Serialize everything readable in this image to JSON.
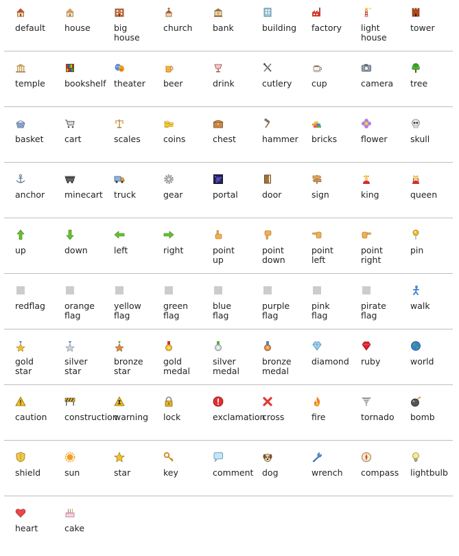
{
  "rows": [
    [
      {
        "label": "default",
        "icon": "default-house-icon"
      },
      {
        "label": "house",
        "icon": "house-icon"
      },
      {
        "label": "big\nhouse",
        "icon": "big-house-icon"
      },
      {
        "label": "church",
        "icon": "church-icon"
      },
      {
        "label": "bank",
        "icon": "bank-icon"
      },
      {
        "label": "building",
        "icon": "building-icon"
      },
      {
        "label": "factory",
        "icon": "factory-icon"
      },
      {
        "label": "light\nhouse",
        "icon": "lighthouse-icon"
      },
      {
        "label": "tower",
        "icon": "tower-icon"
      }
    ],
    [
      {
        "label": "temple",
        "icon": "temple-icon"
      },
      {
        "label": "bookshelf",
        "icon": "bookshelf-icon"
      },
      {
        "label": "theater",
        "icon": "theater-icon"
      },
      {
        "label": "beer",
        "icon": "beer-icon"
      },
      {
        "label": "drink",
        "icon": "drink-icon"
      },
      {
        "label": "cutlery",
        "icon": "cutlery-icon"
      },
      {
        "label": "cup",
        "icon": "cup-icon"
      },
      {
        "label": "camera",
        "icon": "camera-icon"
      },
      {
        "label": "tree",
        "icon": "tree-icon"
      }
    ],
    [
      {
        "label": "basket",
        "icon": "basket-icon"
      },
      {
        "label": "cart",
        "icon": "cart-icon"
      },
      {
        "label": "scales",
        "icon": "scales-icon"
      },
      {
        "label": "coins",
        "icon": "coins-icon"
      },
      {
        "label": "chest",
        "icon": "chest-icon"
      },
      {
        "label": "hammer",
        "icon": "hammer-icon"
      },
      {
        "label": "bricks",
        "icon": "bricks-icon"
      },
      {
        "label": "flower",
        "icon": "flower-icon"
      },
      {
        "label": "skull",
        "icon": "skull-icon"
      }
    ],
    [
      {
        "label": "anchor",
        "icon": "anchor-icon"
      },
      {
        "label": "minecart",
        "icon": "minecart-icon"
      },
      {
        "label": "truck",
        "icon": "truck-icon"
      },
      {
        "label": "gear",
        "icon": "gear-icon"
      },
      {
        "label": "portal",
        "icon": "portal-icon"
      },
      {
        "label": "door",
        "icon": "door-icon"
      },
      {
        "label": "sign",
        "icon": "sign-icon"
      },
      {
        "label": "king",
        "icon": "king-icon"
      },
      {
        "label": "queen",
        "icon": "queen-icon"
      }
    ],
    [
      {
        "label": "up",
        "icon": "arrow-up-icon"
      },
      {
        "label": "down",
        "icon": "arrow-down-icon"
      },
      {
        "label": "left",
        "icon": "arrow-left-icon"
      },
      {
        "label": "right",
        "icon": "arrow-right-icon"
      },
      {
        "label": "point\nup",
        "icon": "point-up-icon"
      },
      {
        "label": "point\ndown",
        "icon": "point-down-icon"
      },
      {
        "label": "point\nleft",
        "icon": "point-left-icon"
      },
      {
        "label": "point\nright",
        "icon": "point-right-icon"
      },
      {
        "label": "pin",
        "icon": "pin-icon"
      }
    ],
    [
      {
        "label": "redflag",
        "icon": "red-flag-icon"
      },
      {
        "label": "orange\nflag",
        "icon": "orange-flag-icon"
      },
      {
        "label": "yellow\nflag",
        "icon": "yellow-flag-icon"
      },
      {
        "label": "green\nflag",
        "icon": "green-flag-icon"
      },
      {
        "label": "blue\nflag",
        "icon": "blue-flag-icon"
      },
      {
        "label": "purple\nflag",
        "icon": "purple-flag-icon"
      },
      {
        "label": "pink\nflag",
        "icon": "pink-flag-icon"
      },
      {
        "label": "pirate\nflag",
        "icon": "pirate-flag-icon"
      },
      {
        "label": "walk",
        "icon": "walk-icon"
      }
    ],
    [
      {
        "label": "gold\nstar",
        "icon": "gold-star-icon"
      },
      {
        "label": "silver\nstar",
        "icon": "silver-star-icon"
      },
      {
        "label": "bronze\nstar",
        "icon": "bronze-star-icon"
      },
      {
        "label": "gold\nmedal",
        "icon": "gold-medal-icon"
      },
      {
        "label": "silver\nmedal",
        "icon": "silver-medal-icon"
      },
      {
        "label": "bronze\nmedal",
        "icon": "bronze-medal-icon"
      },
      {
        "label": "diamond",
        "icon": "diamond-icon"
      },
      {
        "label": "ruby",
        "icon": "ruby-icon"
      },
      {
        "label": "world",
        "icon": "world-icon"
      }
    ],
    [
      {
        "label": "caution",
        "icon": "caution-icon"
      },
      {
        "label": "construction",
        "icon": "construction-icon"
      },
      {
        "label": "warning",
        "icon": "warning-icon"
      },
      {
        "label": "lock",
        "icon": "lock-icon"
      },
      {
        "label": "exclamation",
        "icon": "exclamation-icon"
      },
      {
        "label": "cross",
        "icon": "cross-icon"
      },
      {
        "label": "fire",
        "icon": "fire-icon"
      },
      {
        "label": "tornado",
        "icon": "tornado-icon"
      },
      {
        "label": "bomb",
        "icon": "bomb-icon"
      }
    ],
    [
      {
        "label": "shield",
        "icon": "shield-icon"
      },
      {
        "label": "sun",
        "icon": "sun-icon"
      },
      {
        "label": "star",
        "icon": "star-icon"
      },
      {
        "label": "key",
        "icon": "key-icon"
      },
      {
        "label": "comment",
        "icon": "comment-icon"
      },
      {
        "label": "dog",
        "icon": "dog-icon"
      },
      {
        "label": "wrench",
        "icon": "wrench-icon"
      },
      {
        "label": "compass",
        "icon": "compass-icon"
      },
      {
        "label": "lightbulb",
        "icon": "lightbulb-icon"
      }
    ],
    [
      {
        "label": "heart",
        "icon": "heart-icon"
      },
      {
        "label": "cake",
        "icon": "cake-icon"
      }
    ]
  ]
}
